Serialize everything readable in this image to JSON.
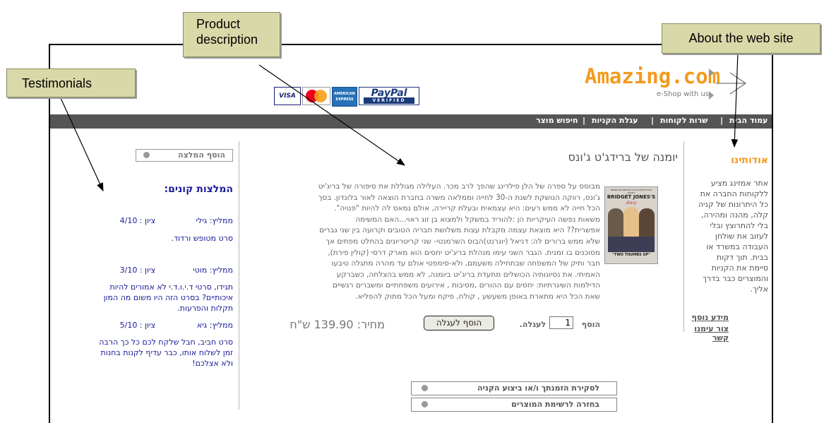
{
  "callouts": {
    "product_description": [
      "Product",
      "description"
    ],
    "about": "About the web site",
    "testimonials": "Testimonials"
  },
  "header": {
    "logo_name": "Amazing.com",
    "logo_tagline": "e-Shop with us",
    "cards": [
      "VISA",
      "MasterCard",
      "AMERICAN EXPRESS",
      "PayPal",
      "VERIFIED"
    ]
  },
  "nav": {
    "items": [
      "עמוד הבית",
      "שרות לקוחות",
      "עגלת הקניות",
      "חיפוש מוצר"
    ],
    "separator": "|"
  },
  "about": {
    "title": "אודותינו",
    "text": [
      "אתר אמזינג מציע",
      "ללקוחות החברה את",
      "כל היתרונות של קניה",
      "קלה, מהנה ומהירה,",
      "בלי להתרוצץ ובלי",
      "לעזוב את שולחן",
      "העבודה במשרד או",
      "בבית. תוך דקות",
      "סיימת את הקניות",
      "והמוצרים כבר בדרך",
      "אליך."
    ],
    "links": [
      "מידע נוסף",
      "צור עימנו קשר"
    ]
  },
  "product": {
    "title": "יומנה של ברידג'ט ג'ונס",
    "poster_title": "BRIDGET JONES'S",
    "poster_sub": "diary",
    "poster_cast": "RENÉE ZELLWEGER  COLIN FIRTH  HUGH GRANT",
    "poster_tagline": "\"TWO THUMBS UP\"",
    "description": [
      "מבוסס על ספרה של הלן פילדינג שהפך לרב מכר. העלילה מגוללת את סיפורה של בריג'יט",
      "ג'ונס, רווקה הנושקת לשנת ה-30 לחייה וממלאה משרה בחברת הוצאה לאור בלונדון. בסך",
      "הכל חייה לא ממש רעים: היא עצמאית ובעלת קריירה, אולם נמאס לה להיות \"פנויה\".",
      "משאות נפשה העיקריות הן :להוריד במשקל ולמצוא בן זוג ראוי...האם המשימה",
      "אפשרית?? היא מוצאת עצמה מקבלת עצות משלושת חבריה הטובים וקרועה בין שני גברים",
      "שלא ממש ברורים לה: דניאל (יוגרנט)הבוס השרמנטי- שני קריטריונים בהחלט מפתים אך",
      "מסוכנים בו זמנית. הגבר השני עימו מנהלת בריג'יט יחסים הוא מארק דרסי (קולין פירת),",
      "חבר ותיק של המשפחה שבתחילה משעמם, ולא-סימפטי אולם עד מהרה מתגלה טיבעו",
      "האמיתי. את נסיונותיה הכושלים מתעדת בריג'יט ביומנה, לא ממש בהצלחה, כשברקע",
      "הדילמות השיגרתיות: יחסים עם ההורים ,מסיבות , אירועים משפחתיים ומשברים רגשיים",
      "שאת הכל היא מתארת באופן משעשע , קולח, פיקח ומעל הכל מתוק להפליא."
    ],
    "price_label": "מחיר: 139.90 ש\"ח",
    "add_label": "הוסף",
    "quantity": "1",
    "to_cart_label": "לעגלה.",
    "add_to_cart_button": "הוסף לעגלה",
    "checkout_button": "לסקירת הזמנתך ו/או ביצוע הקניה",
    "back_button": "בחזרה לרשימת המוצרים"
  },
  "testimonials": {
    "add_button": "הוסף המלצה",
    "title": "המלצות קונים:",
    "items": [
      {
        "recommender": "ממליץ: גילי",
        "score": "ציון : 4/10",
        "text": [
          "סרט מטופש ורדוד."
        ]
      },
      {
        "recommender": "ממליץ: מוטי",
        "score": "ציון : 3/10",
        "text": [
          "תגידו, סרטי ד.י.ו.ד.י לא אמורים להיות",
          "איכותיים? בסרט הזה היו משום מה המון",
          "תקלות והפרעות."
        ]
      },
      {
        "recommender": "ממליץ: גיא",
        "score": "ציון : 5/10",
        "text": [
          "סרט חביב, חבל שלקח לכם כל כך הרבה",
          "זמן לשלוח אותו, כבר עדיף לקנות בחנות",
          "ולא אצלכם!"
        ]
      }
    ]
  }
}
